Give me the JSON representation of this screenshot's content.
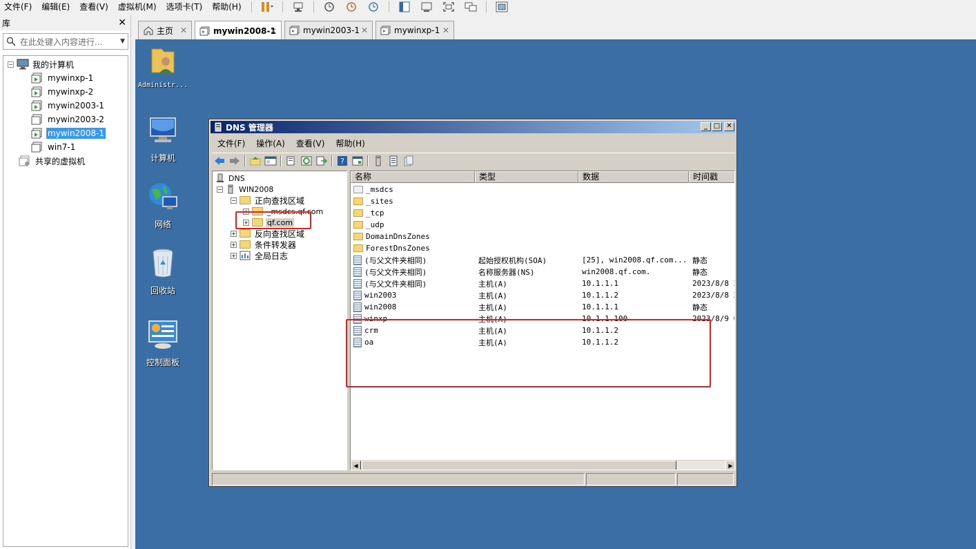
{
  "topbar": {
    "menus": [
      "文件(F)",
      "编辑(E)",
      "查看(V)",
      "虚拟机(M)",
      "选项卡(T)",
      "帮助(H)"
    ]
  },
  "library": {
    "title": "库",
    "search_placeholder": "在此处键入内容进行...",
    "tree": {
      "root": "我的计算机",
      "vms": [
        "mywinxp-1",
        "mywinxp-2",
        "mywin2003-1",
        "mywin2003-2",
        "mywin2008-1",
        "win7-1"
      ],
      "selected": "mywin2008-1",
      "shared": "共享的虚拟机"
    }
  },
  "tabs": [
    {
      "label": "主页",
      "active": false
    },
    {
      "label": "mywin2008-1",
      "active": true
    },
    {
      "label": "mywin2003-1",
      "active": false
    },
    {
      "label": "mywinxp-1",
      "active": false
    }
  ],
  "desktop_icons": [
    {
      "label": "Administr..."
    },
    {
      "label": "计算机"
    },
    {
      "label": "网络"
    },
    {
      "label": "回收站"
    },
    {
      "label": "控制面板"
    }
  ],
  "dns_window": {
    "title": "DNS 管理器",
    "menus": [
      "文件(F)",
      "操作(A)",
      "查看(V)",
      "帮助(H)"
    ],
    "tree": {
      "root": "DNS",
      "server": "WIN2008",
      "forward": "正向查找区域",
      "msdcs": "_msdcs.qf.com",
      "zone": "qf.com",
      "reverse": "反向查找区域",
      "conditional": "条件转发器",
      "global": "全局日志"
    },
    "columns": [
      "名称",
      "类型",
      "数据",
      "时间戳"
    ],
    "rows": [
      {
        "name": "_msdcs",
        "type": "",
        "data": "",
        "timestamp": "",
        "kind": "folder-grey"
      },
      {
        "name": "_sites",
        "type": "",
        "data": "",
        "timestamp": "",
        "kind": "folder"
      },
      {
        "name": "_tcp",
        "type": "",
        "data": "",
        "timestamp": "",
        "kind": "folder"
      },
      {
        "name": "_udp",
        "type": "",
        "data": "",
        "timestamp": "",
        "kind": "folder"
      },
      {
        "name": "DomainDnsZones",
        "type": "",
        "data": "",
        "timestamp": "",
        "kind": "folder"
      },
      {
        "name": "ForestDnsZones",
        "type": "",
        "data": "",
        "timestamp": "",
        "kind": "folder"
      },
      {
        "name": "(与父文件夹相同)",
        "type": "起始授权机构(SOA)",
        "data": "[25], win2008.qf.com....",
        "timestamp": "静态",
        "kind": "record"
      },
      {
        "name": "(与父文件夹相同)",
        "type": "名称服务器(NS)",
        "data": "win2008.qf.com.",
        "timestamp": "静态",
        "kind": "record"
      },
      {
        "name": "(与父文件夹相同)",
        "type": "主机(A)",
        "data": "10.1.1.1",
        "timestamp": "2023/8/8 2",
        "kind": "record"
      },
      {
        "name": "win2003",
        "type": "主机(A)",
        "data": "10.1.1.2",
        "timestamp": "2023/8/8 2",
        "kind": "record"
      },
      {
        "name": "win2008",
        "type": "主机(A)",
        "data": "10.1.1.1",
        "timestamp": "静态",
        "kind": "record"
      },
      {
        "name": "winxp",
        "type": "主机(A)",
        "data": "10.1.1.100",
        "timestamp": "2023/8/9 0",
        "kind": "record"
      },
      {
        "name": "crm",
        "type": "主机(A)",
        "data": "10.1.1.2",
        "timestamp": "",
        "kind": "record"
      },
      {
        "name": "oa",
        "type": "主机(A)",
        "data": "10.1.1.2",
        "timestamp": "",
        "kind": "record"
      }
    ]
  },
  "colors": {
    "desktop": "#3a6ea5",
    "selection": "#3399ff",
    "highlight_box": "#e0201c",
    "title_gradient_start": "#0a246a"
  }
}
